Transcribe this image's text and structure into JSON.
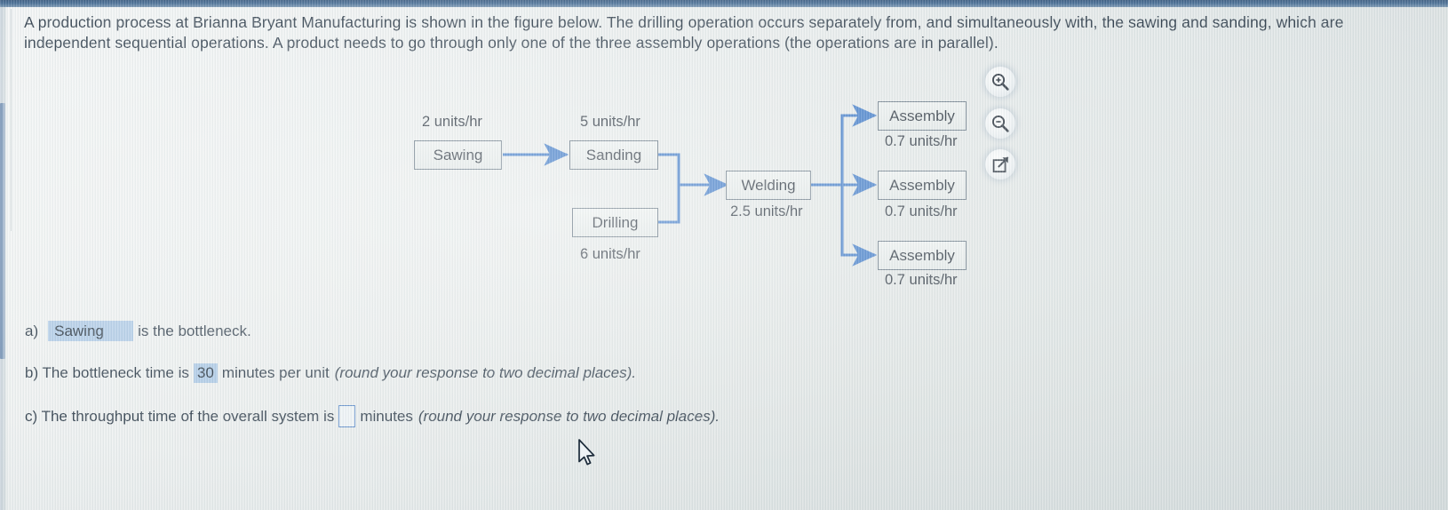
{
  "question": {
    "text": "A production process at Brianna Bryant Manufacturing is shown in the figure below. The drilling operation occurs separately from, and simultaneously with, the sawing and sanding, which are independent sequential operations. A product needs to go through only one of the three assembly operations (the operations are in parallel)."
  },
  "diagram": {
    "nodes": [
      {
        "label": "Sawing",
        "rate": "2 units/hr"
      },
      {
        "label": "Sanding",
        "rate": "5 units/hr"
      },
      {
        "label": "Drilling",
        "rate": "6 units/hr"
      },
      {
        "label": "Welding",
        "rate": "2.5 units/hr"
      },
      {
        "label": "Assembly",
        "rate": "0.7 units/hr"
      },
      {
        "label": "Assembly",
        "rate": "0.7 units/hr"
      },
      {
        "label": "Assembly",
        "rate": "0.7 units/hr"
      }
    ],
    "arrow_color": "#2e6fc4",
    "box_border_color": "#5a6b7a"
  },
  "toolbar": {
    "zoom_in_label": "Zoom in",
    "zoom_out_label": "Zoom out",
    "popout_label": "Open in new window"
  },
  "answers": {
    "a": {
      "prefix": "a)",
      "selected": "Sawing",
      "suffix": "is the bottleneck."
    },
    "b": {
      "prefix": "b) The bottleneck time is",
      "value": "30",
      "mid": "minutes per unit",
      "hint": "(round your response to two decimal places)."
    },
    "c": {
      "prefix": "c) The throughput time of the overall system is",
      "value": "",
      "mid": "minutes",
      "hint": "(round your response to two decimal places)."
    }
  },
  "theme": {
    "page_background": "#dfe4e3",
    "text_color": "#1c2b3a",
    "highlight_fill": "#abc8e6",
    "input_border": "#4b7fc4",
    "chrome_blue": "#315b88"
  }
}
